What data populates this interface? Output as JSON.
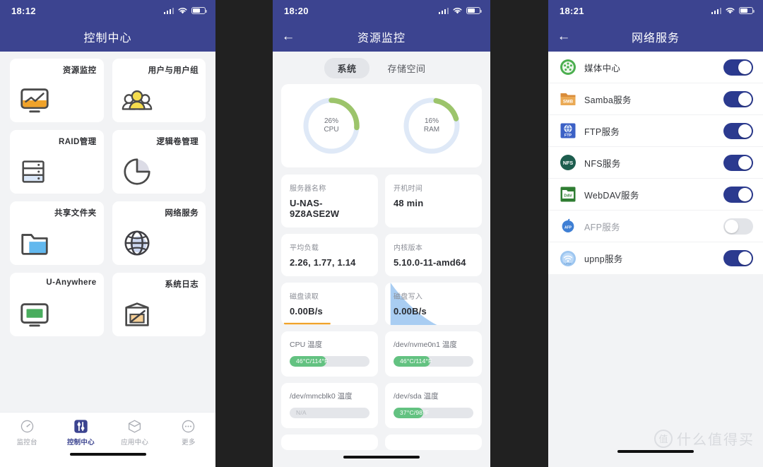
{
  "theme": {
    "header_bg": "#3c4490",
    "page_bg": "#f2f3f5",
    "card_bg": "#ffffff",
    "accent": "#2b3a8f",
    "ok_green": "#63c281",
    "gauge_track": "#dfe9f7",
    "gap_bg": "#212121"
  },
  "watermark": {
    "badge": "值",
    "text": "什么值得买"
  },
  "panel1": {
    "status": {
      "clock": "18:12",
      "signal_icon": "signal-bars-icon",
      "wifi_icon": "wifi-icon",
      "battery_icon": "battery-icon"
    },
    "nav": {
      "title": "控制中心"
    },
    "tiles": [
      {
        "label": "资源监控",
        "icon": "monitor-chart-icon"
      },
      {
        "label": "用户与用户组",
        "icon": "users-group-icon"
      },
      {
        "label": "RAID管理",
        "icon": "disk-stack-icon"
      },
      {
        "label": "逻辑卷管理",
        "icon": "pie-chart-icon"
      },
      {
        "label": "共享文件夹",
        "icon": "folder-icon"
      },
      {
        "label": "网络服务",
        "icon": "globe-icon"
      },
      {
        "label": "U-Anywhere",
        "icon": "desktop-screen-icon"
      },
      {
        "label": "系统日志",
        "icon": "log-pencil-icon"
      }
    ],
    "tabbar": [
      {
        "label": "监控台",
        "icon": "gauge-icon",
        "active": false
      },
      {
        "label": "控制中心",
        "icon": "sliders-icon",
        "active": true
      },
      {
        "label": "应用中心",
        "icon": "cube-icon",
        "active": false
      },
      {
        "label": "更多",
        "icon": "ellipsis-icon",
        "active": false
      }
    ]
  },
  "panel2": {
    "status": {
      "clock": "18:20"
    },
    "nav": {
      "title": "资源监控",
      "back_icon": "back-arrow-icon"
    },
    "tabs": [
      {
        "label": "系统",
        "active": true
      },
      {
        "label": "存储空间",
        "active": false
      }
    ],
    "gauges": [
      {
        "percent_label": "26%",
        "name": "CPU",
        "value": 26
      },
      {
        "percent_label": "16%",
        "name": "RAM",
        "value": 16
      }
    ],
    "info_cards": [
      {
        "key": "服务器名称",
        "value": "U-NAS-9Z8ASE2W",
        "spark": "none"
      },
      {
        "key": "开机时间",
        "value": "48 min",
        "spark": "none"
      },
      {
        "key": "平均负载",
        "value": "2.26, 1.77, 1.14",
        "spark": "none"
      },
      {
        "key": "内核版本",
        "value": "5.10.0-11-amd64",
        "spark": "none"
      },
      {
        "key": "磁盘读取",
        "value": "0.00B/s",
        "spark": "orange-line"
      },
      {
        "key": "磁盘写入",
        "value": "0.00B/s",
        "spark": "blue-area"
      }
    ],
    "temp_cards": [
      {
        "key": "CPU 温度",
        "value": "46°C/114°F",
        "fill_pct": 46,
        "na": false
      },
      {
        "key": "/dev/nvme0n1 温度",
        "value": "46°C/114°F",
        "fill_pct": 46,
        "na": false
      },
      {
        "key": "/dev/mmcblk0 温度",
        "value": "N/A",
        "fill_pct": 0,
        "na": true
      },
      {
        "key": "/dev/sda 温度",
        "value": "37°C/98°F",
        "fill_pct": 37,
        "na": false
      }
    ]
  },
  "panel3": {
    "status": {
      "clock": "18:21"
    },
    "nav": {
      "title": "网络服务",
      "back_icon": "back-arrow-icon"
    },
    "services": [
      {
        "name": "媒体中心",
        "icon": "media-center-icon",
        "enabled": true
      },
      {
        "name": "Samba服务",
        "icon": "smb-folder-icon",
        "enabled": true
      },
      {
        "name": "FTP服务",
        "icon": "ftp-globe-icon",
        "enabled": true
      },
      {
        "name": "NFS服务",
        "icon": "nfs-circle-icon",
        "enabled": true
      },
      {
        "name": "WebDAV服务",
        "icon": "webdav-folder-icon",
        "enabled": true
      },
      {
        "name": "AFP服务",
        "icon": "afp-apple-icon",
        "enabled": false
      },
      {
        "name": "upnp服务",
        "icon": "upnp-wifi-icon",
        "enabled": true
      }
    ]
  }
}
